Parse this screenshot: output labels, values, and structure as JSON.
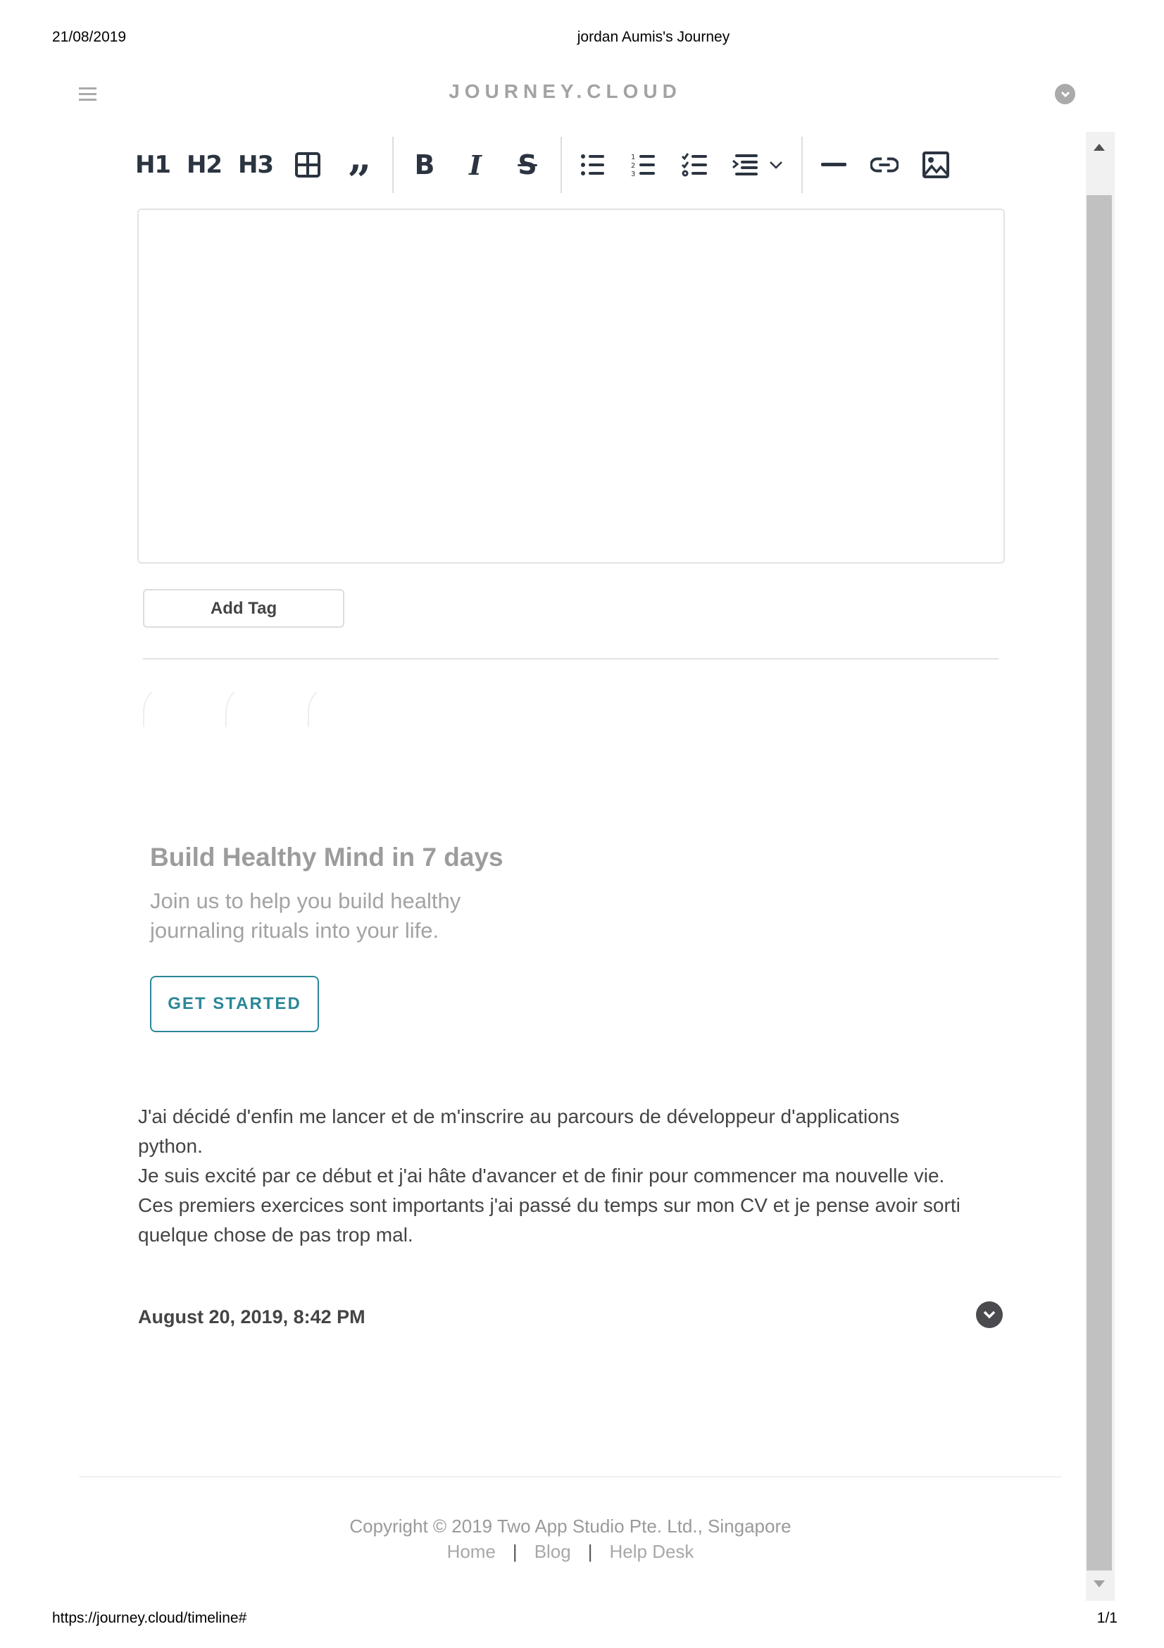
{
  "print_header": {
    "date": "21/08/2019",
    "title": "jordan Aumis's Journey"
  },
  "print_footer": {
    "url": "https://journey.cloud/timeline#",
    "page": "1/1"
  },
  "nav": {
    "logo": "JOURNEY.CLOUD",
    "menu_icon": "hamburger-icon",
    "account_icon": "chevron-down-circle-icon"
  },
  "toolbar": {
    "h1": "H1",
    "h2": "H2",
    "h3": "H3",
    "items": [
      "heading-1",
      "heading-2",
      "heading-3",
      "table",
      "quote",
      "bold",
      "italic",
      "strikethrough",
      "bullet-list",
      "numbered-list",
      "checklist",
      "indent",
      "horizontal-rule",
      "link",
      "image"
    ]
  },
  "editor": {
    "add_tag": "Add Tag"
  },
  "promo": {
    "title": "Build Healthy Mind in 7 days",
    "subtitle_lines": [
      "Join us to help you build healthy",
      "journaling rituals into your life."
    ],
    "cta": "GET STARTED",
    "accent": "#2a8797"
  },
  "entry": {
    "lines": [
      "J'ai décidé d'enfin me lancer et de m'inscrire au parcours de développeur d'applications",
      "python.",
      "Je suis excité par ce début et j'ai hâte d'avancer et de finir pour commencer ma nouvelle vie.",
      "Ces premiers exercices sont importants j'ai passé du temps sur mon CV et je pense avoir sorti",
      "quelque chose de pas trop mal."
    ],
    "date": "August 20, 2019, 8:42 PM"
  },
  "footer": {
    "copyright": "Copyright © 2019 Two App Studio Pte. Ltd., Singapore",
    "links": [
      "Home",
      "Blog",
      "Help Desk"
    ],
    "separator": "|"
  }
}
